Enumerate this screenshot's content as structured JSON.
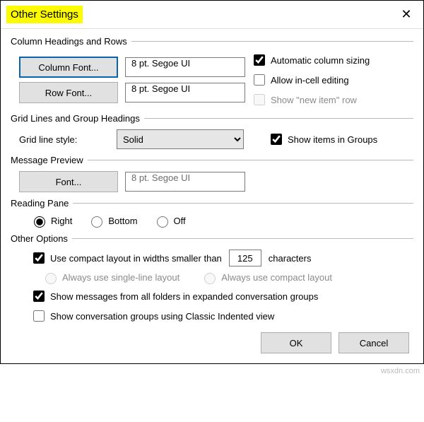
{
  "window": {
    "title": "Other Settings",
    "close_glyph": "✕"
  },
  "groups": {
    "col_headings": {
      "legend": "Column Headings and Rows",
      "column_font_btn": "Column Font...",
      "column_font_val": "8 pt. Segoe UI",
      "row_font_btn": "Row Font...",
      "row_font_val": "8 pt. Segoe UI",
      "auto_col_sizing": "Automatic column sizing",
      "allow_incell": "Allow in-cell editing",
      "show_new_item": "Show \"new item\" row"
    },
    "grid": {
      "legend": "Grid Lines and Group Headings",
      "grid_style_label": "Grid line style:",
      "grid_style_value": "Solid",
      "show_groups": "Show items in Groups"
    },
    "preview": {
      "legend": "Message Preview",
      "font_btn": "Font...",
      "font_val": "8 pt. Segoe UI"
    },
    "reading": {
      "legend": "Reading Pane",
      "right": "Right",
      "bottom": "Bottom",
      "off": "Off"
    },
    "other": {
      "legend": "Other Options",
      "compact_prefix": "Use compact layout in widths smaller than",
      "compact_value": "125",
      "compact_suffix": "characters",
      "always_single": "Always use single-line layout",
      "always_compact": "Always use compact layout",
      "show_all_folders": "Show messages from all folders in expanded conversation groups",
      "classic_indent": "Show conversation groups using Classic Indented view"
    }
  },
  "buttons": {
    "ok": "OK",
    "cancel": "Cancel"
  },
  "watermark": "wsxdn.com"
}
